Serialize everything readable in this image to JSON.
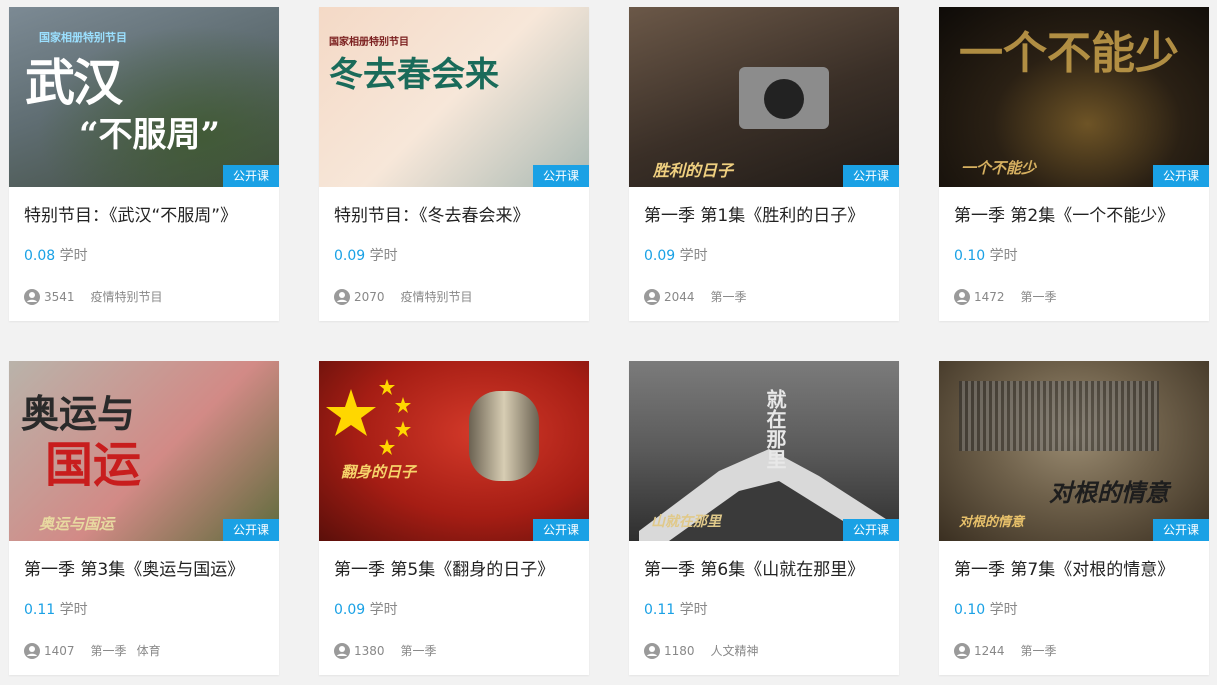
{
  "badge_label": "公开课",
  "hours_unit": "学时",
  "colors": {
    "accent": "#1aa1e5",
    "badge_bg": "#1aa1e5"
  },
  "cards": [
    {
      "title": "特别节目：《武汉“不服周”》",
      "hours": "0.08",
      "count": "3541",
      "tags": [
        "疫情特别节目"
      ],
      "thumb_text": [
        "武汉",
        "“不服周”",
        "国家相册特别节目"
      ]
    },
    {
      "title": "特别节目：《冬去春会来》",
      "hours": "0.09",
      "count": "2070",
      "tags": [
        "疫情特别节目"
      ],
      "thumb_text": [
        "冬去春会来",
        "国家相册特别节目"
      ]
    },
    {
      "title": "第一季 第1集《胜利的日子》",
      "hours": "0.09",
      "count": "2044",
      "tags": [
        "第一季"
      ],
      "thumb_text": [
        "胜利的日子"
      ]
    },
    {
      "title": "第一季 第2集《一个不能少》",
      "hours": "0.10",
      "count": "1472",
      "tags": [
        "第一季"
      ],
      "thumb_text": [
        "一个不能少",
        "一个不能少"
      ]
    },
    {
      "title": "第一季 第3集《奥运与国运》",
      "hours": "0.11",
      "count": "1407",
      "tags": [
        "第一季",
        "体育"
      ],
      "thumb_text": [
        "奥运与",
        "国运",
        "奥运与国运"
      ]
    },
    {
      "title": "第一季 第5集《翻身的日子》",
      "hours": "0.09",
      "count": "1380",
      "tags": [
        "第一季"
      ],
      "thumb_text": [
        "翻身的日子"
      ]
    },
    {
      "title": "第一季 第6集《山就在那里》",
      "hours": "0.11",
      "count": "1180",
      "tags": [
        "人文精神"
      ],
      "thumb_text": [
        "就在那里",
        "山就在那里"
      ]
    },
    {
      "title": "第一季 第7集《对根的情意》",
      "hours": "0.10",
      "count": "1244",
      "tags": [
        "第一季"
      ],
      "thumb_text": [
        "对根的情意",
        "对根的情意"
      ]
    }
  ]
}
